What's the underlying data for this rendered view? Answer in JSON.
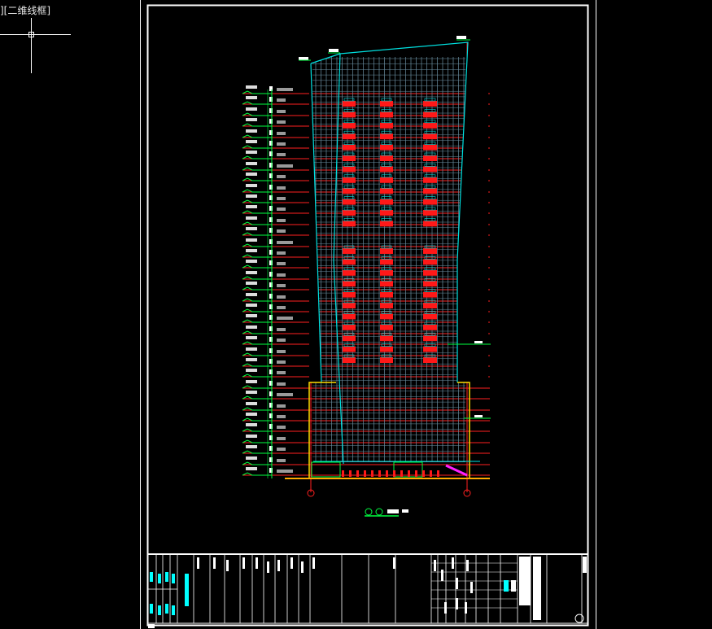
{
  "viewport": {
    "label": "][二维线框]"
  },
  "colors": {
    "background": "#000000",
    "sheet_border": "#ffffff",
    "floor_line": "#ff2020",
    "curtain_wall": "#00e0e0",
    "level_marker": "#00ff40",
    "podium": "#ffdd00",
    "window_red": "#ff1818",
    "magenta": "#ff20ff",
    "title_cyan": "#00ffff"
  },
  "drawing": {
    "name": "elevation",
    "grid_axes": [
      "①",
      "⑧"
    ]
  },
  "icons": [
    "crosshair-cursor-icon",
    "axis-bubble-icon",
    "north-circle-icon"
  ]
}
